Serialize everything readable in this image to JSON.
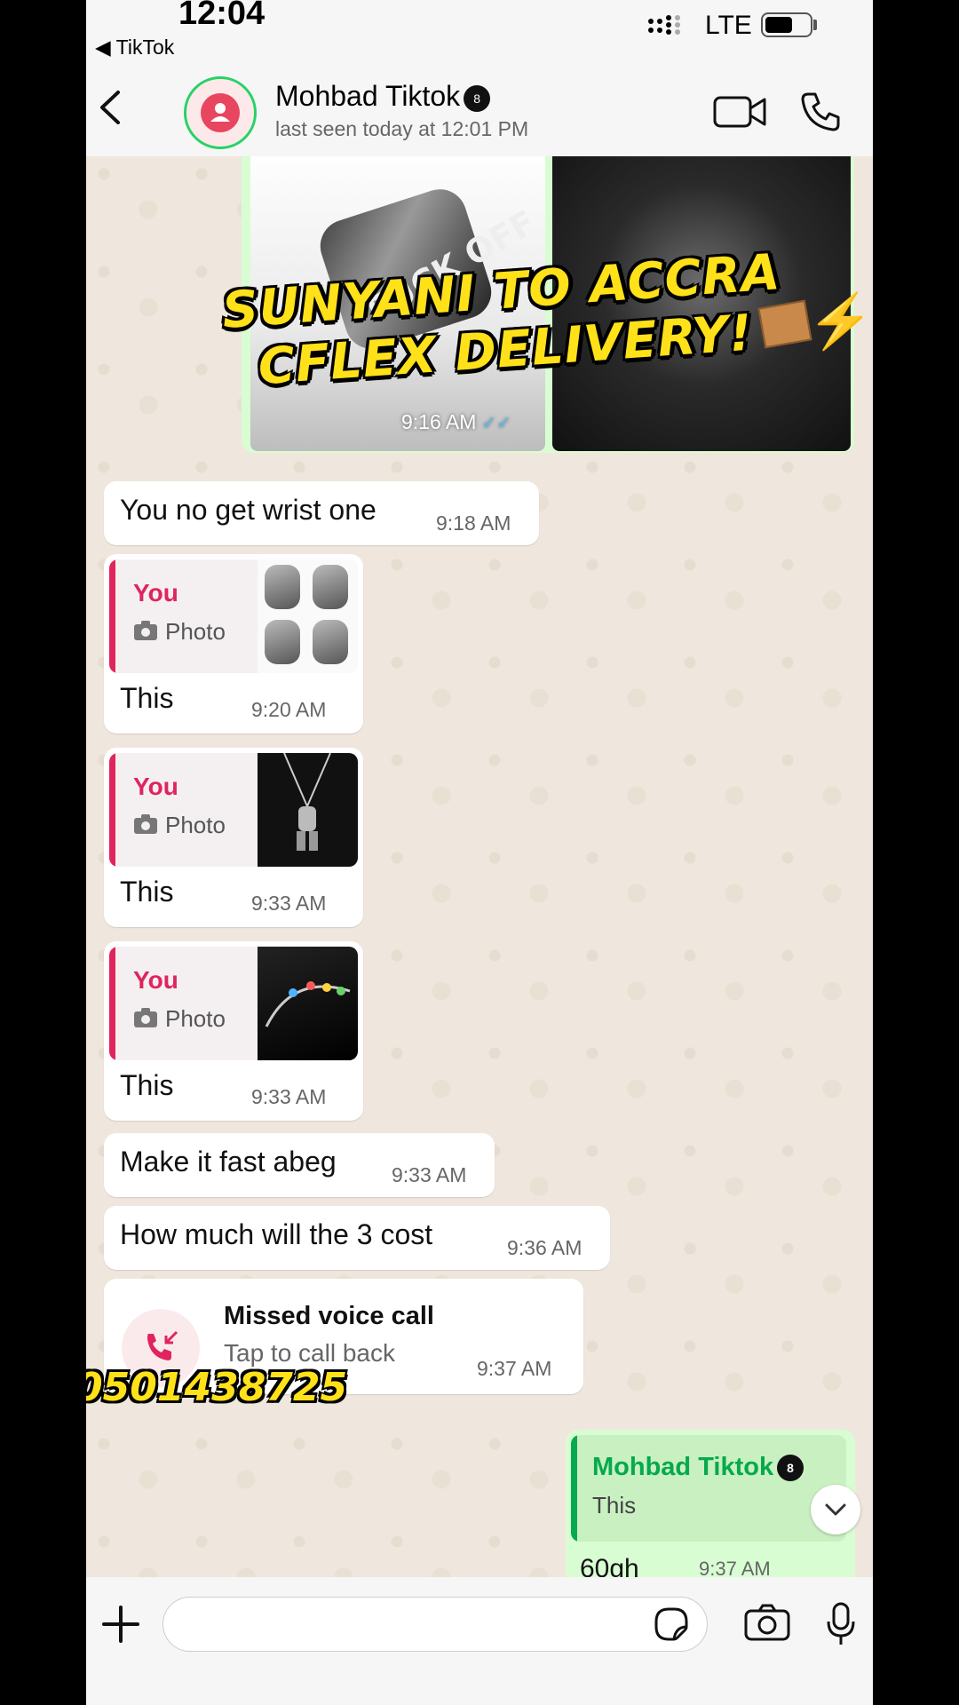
{
  "status_bar": {
    "time": "12:04",
    "back_app": "◀ TikTok",
    "network": "LTE",
    "battery_level": 0.6
  },
  "header": {
    "contact_name": "Mohbad Tiktok",
    "contact_emoji": "8",
    "last_seen": "last seen today at 12:01 PM"
  },
  "media_message": {
    "time": "9:16 AM",
    "ring_text": "FUCK OFF"
  },
  "overlay": {
    "line1": "SUNYANI TO ACCRA",
    "line2": "CFLEX DELIVERY!",
    "phone_number": "0501438725"
  },
  "messages": [
    {
      "text": "You no get wrist one",
      "time": "9:18 AM"
    },
    {
      "quote_author": "You",
      "quote_type": "Photo",
      "text": "This",
      "time": "9:20 AM"
    },
    {
      "quote_author": "You",
      "quote_type": "Photo",
      "text": "This",
      "time": "9:33 AM"
    },
    {
      "quote_author": "You",
      "quote_type": "Photo",
      "text": "This",
      "time": "9:33 AM"
    },
    {
      "text": "Make it fast abeg",
      "time": "9:33 AM"
    },
    {
      "text": "How much will the 3 cost",
      "time": "9:36 AM"
    }
  ],
  "missed_call": {
    "title": "Missed voice call",
    "subtitle": "Tap to call back",
    "time": "9:37 AM"
  },
  "outgoing": {
    "quote_name": "Mohbad Tiktok",
    "quote_text": "This",
    "text": "60gh",
    "time": "9:37 AM"
  },
  "input": {
    "placeholder": ""
  },
  "colors": {
    "accent_green": "#25d366",
    "quote_red": "#e0245e",
    "bubble_out": "#d9fdd3",
    "tick_blue": "#53bdeb"
  }
}
